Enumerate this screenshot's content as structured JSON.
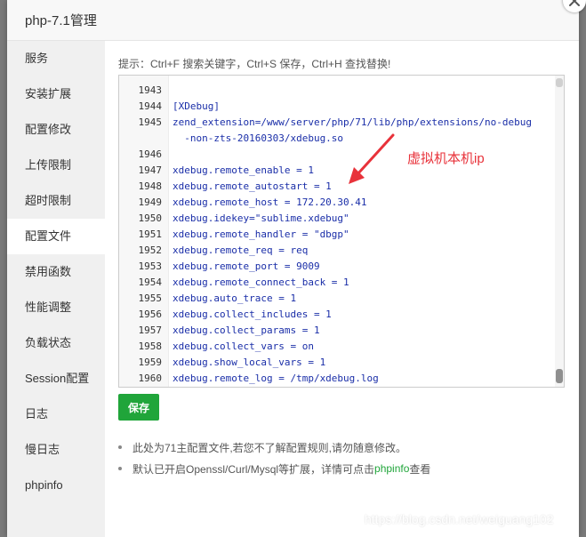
{
  "dialog": {
    "title": "php-7.1管理"
  },
  "sidebar": {
    "items": [
      {
        "label": "服务"
      },
      {
        "label": "安装扩展"
      },
      {
        "label": "配置修改"
      },
      {
        "label": "上传限制"
      },
      {
        "label": "超时限制"
      },
      {
        "label": "配置文件",
        "active": true
      },
      {
        "label": "禁用函数"
      },
      {
        "label": "性能调整"
      },
      {
        "label": "负载状态"
      },
      {
        "label": "Session配置"
      },
      {
        "label": "日志"
      },
      {
        "label": "慢日志"
      },
      {
        "label": "phpinfo"
      }
    ]
  },
  "content": {
    "tip": "提示：Ctrl+F 搜索关键字，Ctrl+S 保存，Ctrl+H 查找替换!",
    "editor_lines": [
      {
        "no": "1943",
        "text": ""
      },
      {
        "no": "1944",
        "text": "[XDebug]"
      },
      {
        "no": "1945",
        "text": "zend_extension=/www/server/php/71/lib/php/extensions/no-debug"
      },
      {
        "no": "",
        "text": "  -non-zts-20160303/xdebug.so"
      },
      {
        "no": "1946",
        "text": ""
      },
      {
        "no": "1947",
        "text": "xdebug.remote_enable = 1"
      },
      {
        "no": "1948",
        "text": "xdebug.remote_autostart = 1"
      },
      {
        "no": "1949",
        "text": "xdebug.remote_host = 172.20.30.41"
      },
      {
        "no": "1950",
        "text": "xdebug.idekey=\"sublime.xdebug\""
      },
      {
        "no": "1951",
        "text": "xdebug.remote_handler = \"dbgp\""
      },
      {
        "no": "1952",
        "text": "xdebug.remote_req = req"
      },
      {
        "no": "1953",
        "text": "xdebug.remote_port = 9009"
      },
      {
        "no": "1954",
        "text": "xdebug.remote_connect_back = 1"
      },
      {
        "no": "1955",
        "text": "xdebug.auto_trace = 1"
      },
      {
        "no": "1956",
        "text": "xdebug.collect_includes = 1"
      },
      {
        "no": "1957",
        "text": "xdebug.collect_params = 1"
      },
      {
        "no": "1958",
        "text": "xdebug.collect_vars = on"
      },
      {
        "no": "1959",
        "text": "xdebug.show_local_vars = 1"
      },
      {
        "no": "1960",
        "text": "xdebug.remote_log = /tmp/xdebug.log"
      }
    ],
    "annotation": "虚拟机本机ip",
    "save_label": "保存",
    "notes": [
      {
        "text": "此处为71主配置文件,若您不了解配置规则,请勿随意修改。"
      },
      {
        "text": "默认已开启Openssl/Curl/Mysql等扩展，详情可点击",
        "link": "phpinfo",
        "suffix": "查看"
      }
    ]
  },
  "watermark": "https://blog.csdn.net/weiguang102",
  "colors": {
    "accent": "#20a53a",
    "annotation": "#e8323a",
    "code_text": "#1a2ea8"
  },
  "icons": {
    "close": "close-icon"
  }
}
